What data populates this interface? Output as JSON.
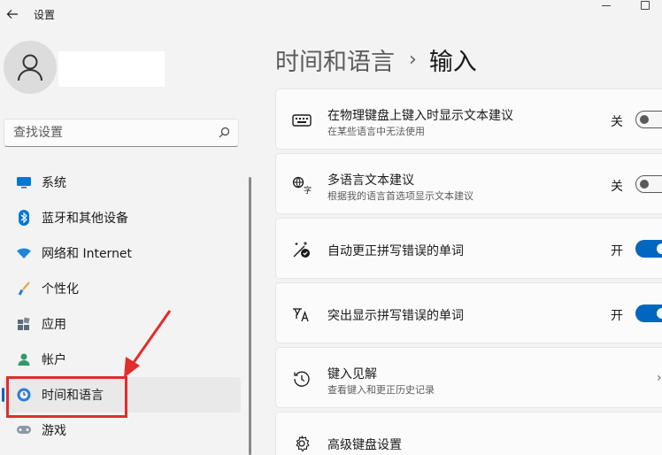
{
  "app": {
    "title": "设置"
  },
  "search": {
    "placeholder": "查找设置"
  },
  "sidebar": {
    "items": [
      {
        "label": "系统",
        "icon": "monitor-icon"
      },
      {
        "label": "蓝牙和其他设备",
        "icon": "bluetooth-icon"
      },
      {
        "label": "网络和 Internet",
        "icon": "wifi-icon"
      },
      {
        "label": "个性化",
        "icon": "brush-icon"
      },
      {
        "label": "应用",
        "icon": "apps-icon"
      },
      {
        "label": "帐户",
        "icon": "person-icon"
      },
      {
        "label": "时间和语言",
        "icon": "clock-globe-icon",
        "selected": true
      },
      {
        "label": "游戏",
        "icon": "gamepad-icon"
      }
    ]
  },
  "breadcrumb": {
    "parent": "时间和语言",
    "separator": "›",
    "current": "输入"
  },
  "settings": [
    {
      "title": "在物理键盘上键入时显示文本建议",
      "desc": "在某些语言中无法使用",
      "state": "关",
      "on": false,
      "icon": "keyboard-icon"
    },
    {
      "title": "多语言文本建议",
      "desc": "根据我的语言首选项显示文本建议",
      "state": "关",
      "on": false,
      "icon": "language-icon"
    },
    {
      "title": "自动更正拼写错误的单词",
      "state": "开",
      "on": true,
      "icon": "autocorrect-icon"
    },
    {
      "title": "突出显示拼写错误的单词",
      "state": "开",
      "on": true,
      "icon": "spellcheck-icon"
    },
    {
      "title": "键入见解",
      "desc": "查看键入和更正历史记录",
      "icon": "history-icon"
    },
    {
      "title": "高级键盘设置",
      "icon": "gear-icon"
    }
  ],
  "colors": {
    "accent": "#0067c0",
    "annotation": "#e32b2b"
  }
}
